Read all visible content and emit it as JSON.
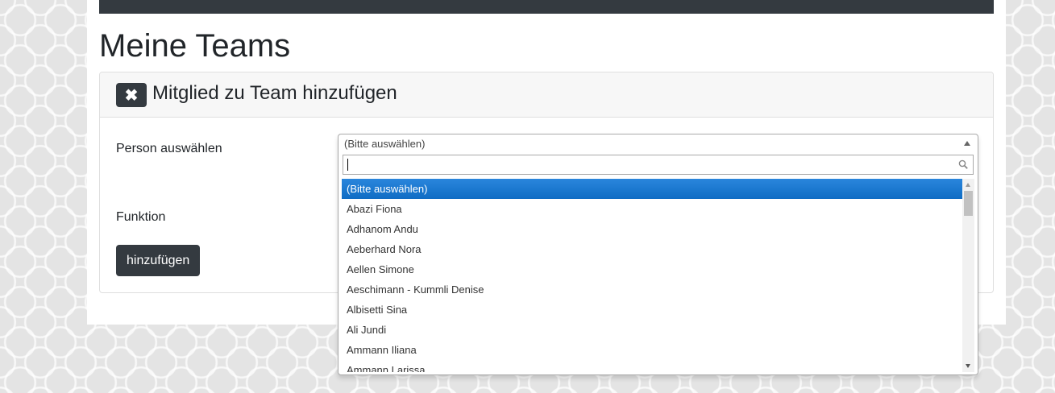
{
  "page": {
    "title": "Meine Teams"
  },
  "card": {
    "title": "Mitglied zu Team hinzufügen",
    "close_icon": "close-icon"
  },
  "form": {
    "person_label": "Person auswählen",
    "function_label": "Funktion",
    "submit_label": "hinzufügen"
  },
  "person_select": {
    "selected": "(Bitte auswählen)",
    "search_value": "",
    "options": [
      "(Bitte auswählen)",
      "Abazi Fiona",
      "Adhanom Andu",
      "Aeberhard Nora",
      "Aellen Simone",
      "Aeschimann - Kummli Denise",
      "Albisetti Sina",
      "Ali Jundi",
      "Ammann Iliana",
      "Ammann Larissa"
    ],
    "highlighted_index": 0
  },
  "colors": {
    "dark": "#343a40",
    "highlight": "#1f78d1"
  }
}
